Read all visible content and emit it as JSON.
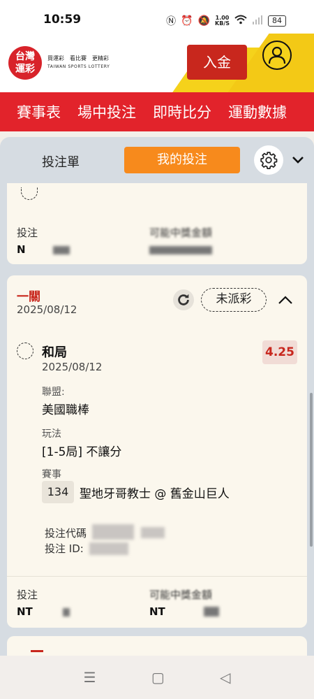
{
  "status_bar": {
    "time": "10:59",
    "network_speed": "1.00\nKB/S",
    "battery": "84",
    "icons": [
      "nfc-icon",
      "alarm-icon",
      "mute-icon",
      "wifi-icon",
      "signal-icon",
      "battery-icon"
    ]
  },
  "header": {
    "logo_main": "台灣\n運彩",
    "logo_slogan": "買運彩　看比賽　更精彩",
    "logo_en": "TAIWAN SPORTS LOTTERY",
    "deposit_label": "入金"
  },
  "nav": {
    "items": [
      "賽事表",
      "場中投注",
      "即時比分",
      "運動數據"
    ]
  },
  "tabs": {
    "bet_slip": "投注單",
    "my_bets": "我的投注"
  },
  "card1": {
    "stake_label": "投注",
    "stake_value": "N",
    "payout_label": "可能中獎金額"
  },
  "card2": {
    "type": "一關",
    "date": "2025/08/12",
    "status": "未派彩",
    "selection": {
      "name": "和局",
      "date": "2025/08/12",
      "odds": "4.25"
    },
    "league_label": "聯盟:",
    "league": "美國職棒",
    "market_label": "玩法",
    "market": "[1-5局] 不讓分",
    "event_label": "賽事",
    "game_no": "134",
    "game_name": "聖地牙哥教士 @ 舊金山巨人",
    "code_label": "投注代碼",
    "id_label": "投注 ID:",
    "stake_label": "投注",
    "stake_value": "NT",
    "payout_label": "可能中獎金額",
    "payout_value": "NT"
  },
  "colors": {
    "brand_red": "#e2232b",
    "deposit_red": "#c8271d",
    "active_tab": "#f78a1c",
    "header_yellow": "#f5d21b",
    "card_bg": "#fbf7ed"
  }
}
